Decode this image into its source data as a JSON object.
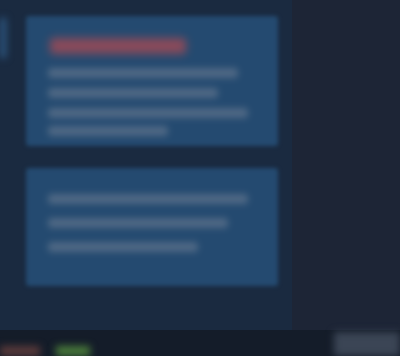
{
  "screen": {
    "description_hidden": "",
    "colors": {
      "background": "#1c2637",
      "content_panel": "#1a2a40",
      "card": "#244a70",
      "text_placeholder": "#5e738c",
      "title_accent": "#8a4a5a",
      "bottom_bar": "#141c29",
      "status_red": "#5a3a3a",
      "status_green": "#4a7b3a"
    }
  },
  "cards": [
    {
      "title": "",
      "lines": [
        "",
        "",
        "",
        ""
      ]
    },
    {
      "title": "",
      "lines": [
        "",
        "",
        ""
      ]
    }
  ],
  "status_bar": {
    "left_text": "",
    "right_text": ""
  }
}
